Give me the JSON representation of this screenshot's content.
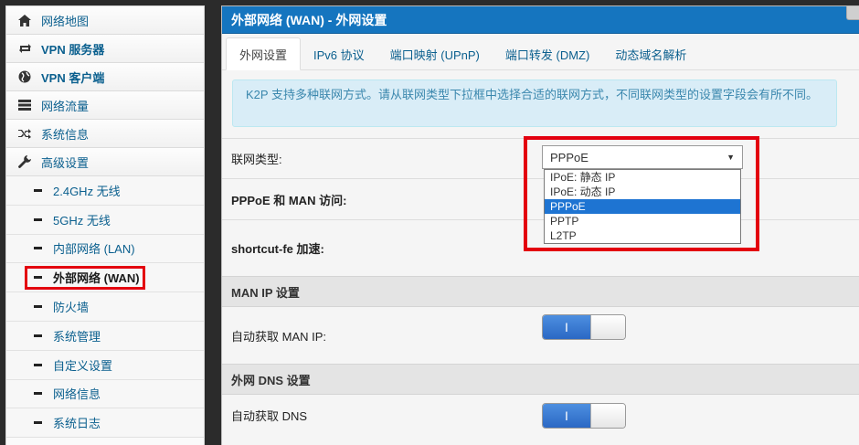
{
  "sidebar": {
    "main_items": [
      {
        "label": "网络地图",
        "icon": "home-icon"
      },
      {
        "label": "VPN 服务器",
        "icon": "loop-arrows-icon"
      },
      {
        "label": "VPN 客户端",
        "icon": "globe-icon"
      },
      {
        "label": "网络流量",
        "icon": "list-icon"
      },
      {
        "label": "系统信息",
        "icon": "shuffle-icon"
      },
      {
        "label": "高级设置",
        "icon": "wrench-icon"
      }
    ],
    "sub_items": [
      {
        "label": "2.4GHz 无线"
      },
      {
        "label": "5GHz 无线"
      },
      {
        "label": "内部网络 (LAN)"
      },
      {
        "label": "外部网络 (WAN)"
      },
      {
        "label": "防火墙"
      },
      {
        "label": "系统管理"
      },
      {
        "label": "自定义设置"
      },
      {
        "label": "网络信息"
      },
      {
        "label": "系统日志"
      }
    ]
  },
  "panel": {
    "title": "外部网络 (WAN) - 外网设置",
    "tabs": [
      "外网设置",
      "IPv6 协议",
      "端口映射 (UPnP)",
      "端口转发 (DMZ)",
      "动态域名解析"
    ],
    "info": "K2P 支持多种联网方式。请从联网类型下拉框中选择合适的联网方式，不同联网类型的设置字段会有所不同。",
    "wan_type_label": "联网类型:",
    "wan_type_value": "PPPoE",
    "wan_type_options": [
      "IPoE: 静态 IP",
      "IPoE: 动态 IP",
      "PPPoE",
      "PPTP",
      "L2TP"
    ],
    "pppoe_man_label": "PPPoE 和 MAN 访问:",
    "shortcut_label": "shortcut-fe 加速:",
    "man_section": "MAN IP 设置",
    "auto_man_label": "自动获取 MAN IP:",
    "dns_section": "外网 DNS 设置",
    "auto_dns_label": "自动获取 DNS",
    "toggle_on_glyph": "I"
  }
}
